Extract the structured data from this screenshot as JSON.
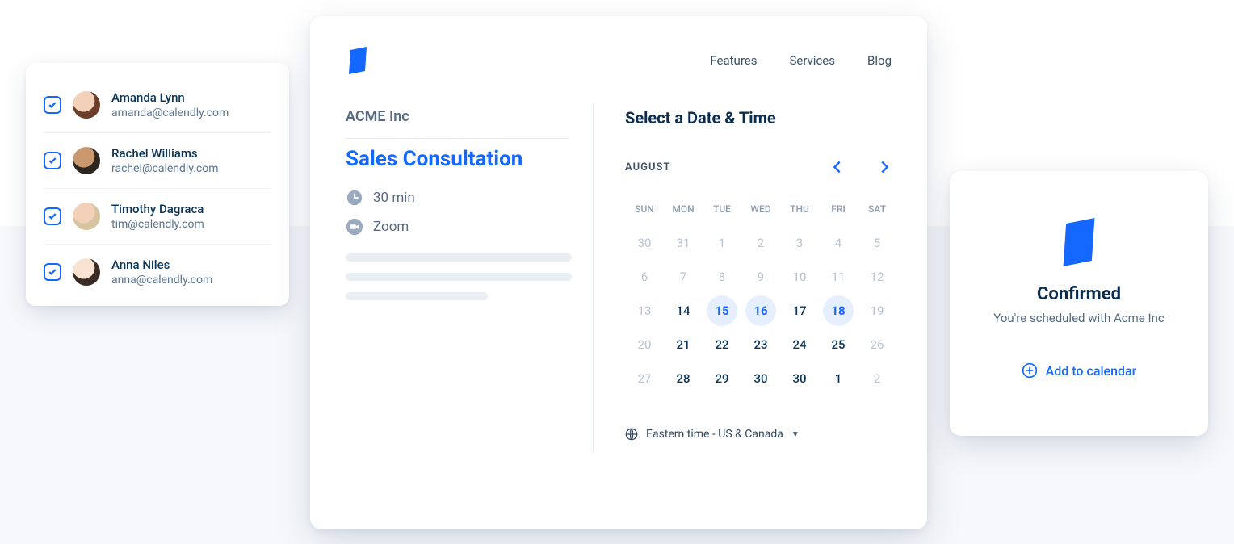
{
  "people": [
    {
      "name": "Amanda Lynn",
      "email": "amanda@calendly.com"
    },
    {
      "name": "Rachel Williams",
      "email": "rachel@calendly.com"
    },
    {
      "name": "Timothy Dagraca",
      "email": "tim@calendly.com"
    },
    {
      "name": "Anna Niles",
      "email": "anna@calendly.com"
    }
  ],
  "nav": {
    "features": "Features",
    "services": "Services",
    "blog": "Blog"
  },
  "booking": {
    "org": "ACME Inc",
    "event_title": "Sales Consultation",
    "duration": "30 min",
    "location": "Zoom"
  },
  "calendar": {
    "select_title": "Select a Date & Time",
    "month": "AUGUST",
    "dow": [
      "SUN",
      "MON",
      "TUE",
      "WED",
      "THU",
      "FRI",
      "SAT"
    ],
    "rows": [
      [
        {
          "n": "30",
          "state": "muted"
        },
        {
          "n": "31",
          "state": "muted"
        },
        {
          "n": "1",
          "state": "muted"
        },
        {
          "n": "2",
          "state": "muted"
        },
        {
          "n": "3",
          "state": "muted"
        },
        {
          "n": "4",
          "state": "muted"
        },
        {
          "n": "5",
          "state": "muted"
        }
      ],
      [
        {
          "n": "6",
          "state": "muted"
        },
        {
          "n": "7",
          "state": "muted"
        },
        {
          "n": "8",
          "state": "muted"
        },
        {
          "n": "9",
          "state": "muted"
        },
        {
          "n": "10",
          "state": "muted"
        },
        {
          "n": "11",
          "state": "muted"
        },
        {
          "n": "12",
          "state": "muted"
        }
      ],
      [
        {
          "n": "13",
          "state": "muted"
        },
        {
          "n": "14",
          "state": "normal"
        },
        {
          "n": "15",
          "state": "avail"
        },
        {
          "n": "16",
          "state": "avail"
        },
        {
          "n": "17",
          "state": "normal"
        },
        {
          "n": "18",
          "state": "avail"
        },
        {
          "n": "19",
          "state": "muted"
        }
      ],
      [
        {
          "n": "20",
          "state": "muted"
        },
        {
          "n": "21",
          "state": "normal"
        },
        {
          "n": "22",
          "state": "normal"
        },
        {
          "n": "23",
          "state": "normal"
        },
        {
          "n": "24",
          "state": "normal"
        },
        {
          "n": "25",
          "state": "normal"
        },
        {
          "n": "26",
          "state": "muted"
        }
      ],
      [
        {
          "n": "27",
          "state": "muted"
        },
        {
          "n": "28",
          "state": "normal"
        },
        {
          "n": "29",
          "state": "normal"
        },
        {
          "n": "30",
          "state": "normal"
        },
        {
          "n": "30",
          "state": "normal"
        },
        {
          "n": "1",
          "state": "normal"
        },
        {
          "n": "2",
          "state": "muted"
        }
      ]
    ],
    "timezone": "Eastern time - US & Canada"
  },
  "confirm": {
    "title": "Confirmed",
    "subtitle": "You're scheduled with Acme Inc",
    "add_label": "Add to calendar"
  },
  "colors": {
    "accent": "#1568ff"
  }
}
